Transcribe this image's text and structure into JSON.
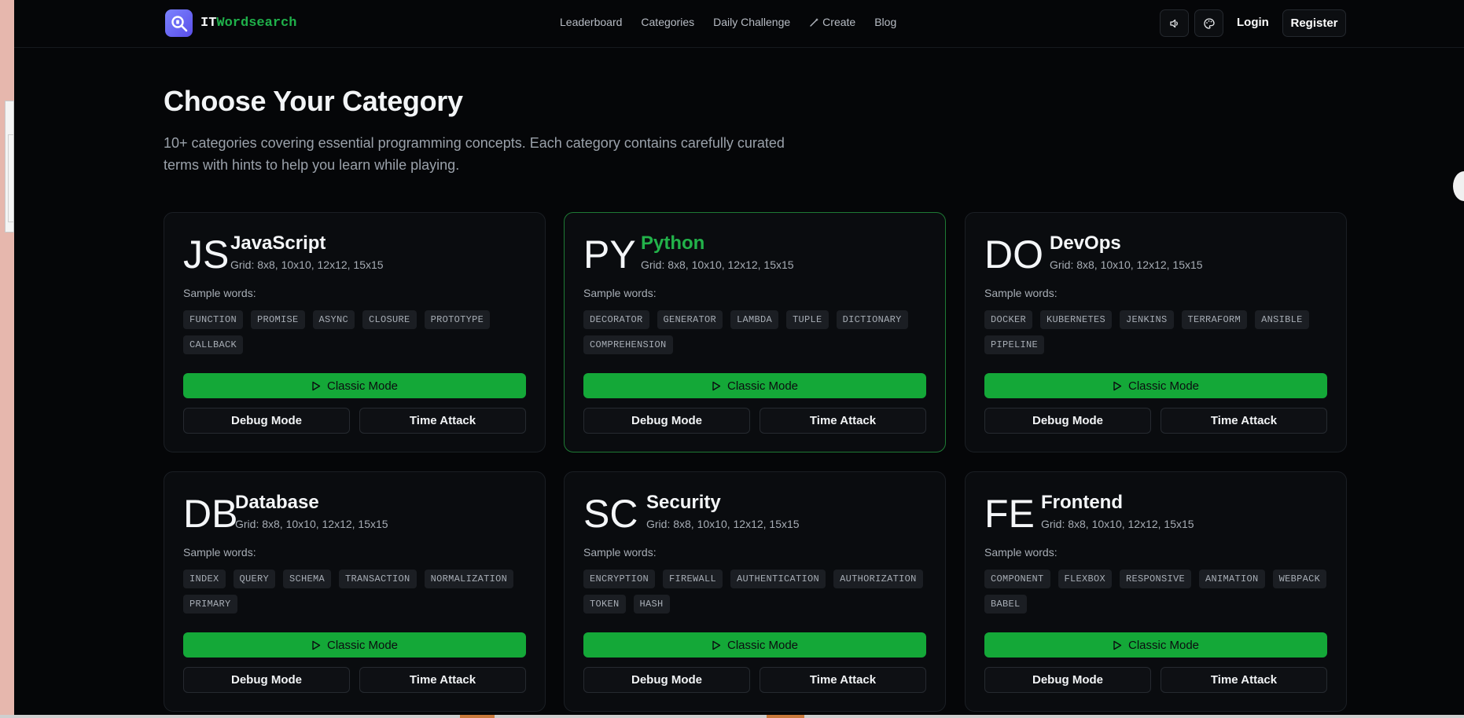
{
  "brand": {
    "name_prefix": "IT",
    "name_accent": "Wordsearch"
  },
  "nav": [
    {
      "label": "Leaderboard"
    },
    {
      "label": "Categories"
    },
    {
      "label": "Daily Challenge"
    },
    {
      "label": "Create"
    },
    {
      "label": "Blog"
    }
  ],
  "header": {
    "login_label": "Login",
    "register_label": "Register"
  },
  "hero": {
    "title": "Choose Your Category",
    "subtitle": "10+ categories covering essential programming concepts. Each category contains carefully curated terms with hints to help you learn while playing."
  },
  "common": {
    "sample_label": "Sample words:",
    "classic_label": "Classic Mode",
    "debug_label": "Debug Mode",
    "time_label": "Time Attack"
  },
  "categories": [
    {
      "abbr": "JS",
      "name": "JavaScript",
      "grid": "Grid: 8x8, 10x10, 12x12, 15x15",
      "words": [
        "FUNCTION",
        "PROMISE",
        "ASYNC",
        "CLOSURE",
        "PROTOTYPE",
        "CALLBACK"
      ]
    },
    {
      "abbr": "PY",
      "name": "Python",
      "grid": "Grid: 8x8, 10x10, 12x12, 15x15",
      "words": [
        "DECORATOR",
        "GENERATOR",
        "LAMBDA",
        "TUPLE",
        "DICTIONARY",
        "COMPREHENSION"
      ]
    },
    {
      "abbr": "DO",
      "name": "DevOps",
      "grid": "Grid: 8x8, 10x10, 12x12, 15x15",
      "words": [
        "DOCKER",
        "KUBERNETES",
        "JENKINS",
        "TERRAFORM",
        "ANSIBLE",
        "PIPELINE"
      ]
    },
    {
      "abbr": "DB",
      "name": "Database",
      "grid": "Grid: 8x8, 10x10, 12x12, 15x15",
      "words": [
        "INDEX",
        "QUERY",
        "SCHEMA",
        "TRANSACTION",
        "NORMALIZATION",
        "PRIMARY"
      ]
    },
    {
      "abbr": "SC",
      "name": "Security",
      "grid": "Grid: 8x8, 10x10, 12x12, 15x15",
      "words": [
        "ENCRYPTION",
        "FIREWALL",
        "AUTHENTICATION",
        "AUTHORIZATION",
        "TOKEN",
        "HASH"
      ]
    },
    {
      "abbr": "FE",
      "name": "Frontend",
      "grid": "Grid: 8x8, 10x10, 12x12, 15x15",
      "words": [
        "COMPONENT",
        "FLEXBOX",
        "RESPONSIVE",
        "ANIMATION",
        "WEBPACK",
        "BABEL"
      ]
    }
  ],
  "colors": {
    "accent": "#14a838",
    "background": "#050608",
    "active_border": "#1e7a34"
  }
}
